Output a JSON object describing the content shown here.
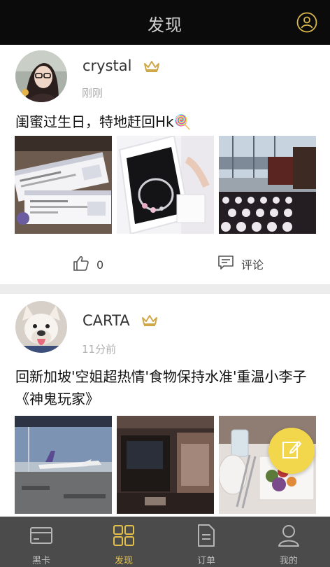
{
  "header": {
    "title": "发现",
    "profile_icon": "user-circle-icon"
  },
  "colors": {
    "accent": "#e2c04a",
    "header_bg": "#0b0b0b",
    "tabbar_bg": "#4b4b4b",
    "fab_bg": "#f2d64b"
  },
  "posts": [
    {
      "username": "crystal",
      "badge_icon": "crown-icon",
      "time": "刚刚",
      "text": "闺蜜过生日，特地赶回Hk🍭",
      "photos": [
        "boarding-passes-photo",
        "bracelet-gift-box-photo",
        "airport-lounge-photo"
      ],
      "like_count": "0",
      "comment_label": "评论"
    },
    {
      "username": "CARTA",
      "badge_icon": "crown-icon",
      "time": "11分前",
      "text": "回新加坡'空姐超热情'食物保持水准'重温小李子《神鬼玩家》",
      "photos": [
        "airport-tarmac-photo",
        "cabin-seat-photo",
        "inflight-meal-photo"
      ]
    }
  ],
  "fab": {
    "icon": "edit-icon"
  },
  "tabbar": [
    {
      "label": "黑卡",
      "icon": "card-icon",
      "active": false
    },
    {
      "label": "发现",
      "icon": "grid-icon",
      "active": true
    },
    {
      "label": "订单",
      "icon": "document-icon",
      "active": false
    },
    {
      "label": "我的",
      "icon": "person-icon",
      "active": false
    }
  ]
}
